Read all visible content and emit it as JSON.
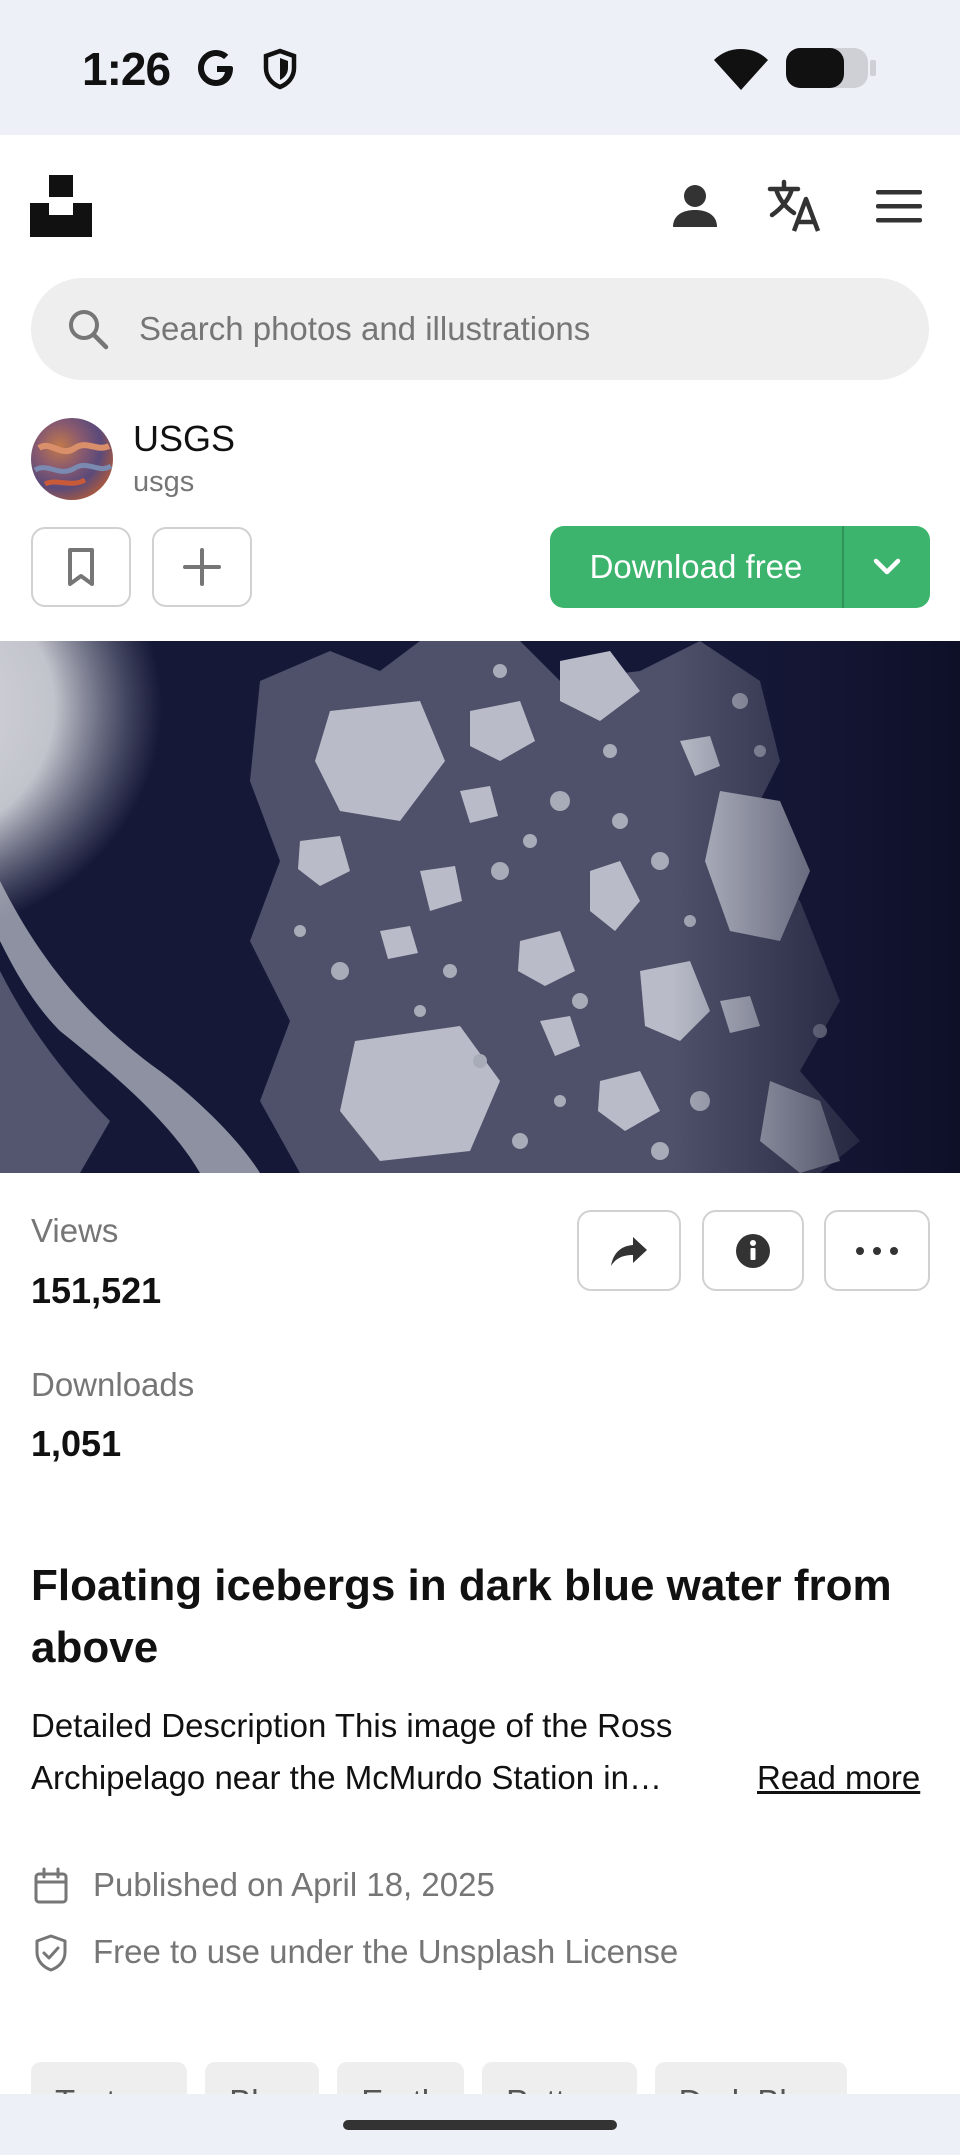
{
  "status_bar": {
    "time": "1:26",
    "g_label": "G"
  },
  "header": {
    "logo_icon": "unsplash-logo",
    "icons": [
      "user-icon",
      "translate-icon",
      "hamburger-menu-icon"
    ]
  },
  "search": {
    "placeholder": "Search photos and illustrations"
  },
  "author": {
    "name": "USGS",
    "handle": "usgs"
  },
  "actions": {
    "bookmark_icon": "bookmark-icon",
    "add_icon": "plus-icon",
    "download_label": "Download free",
    "download_color": "#3cb46e"
  },
  "photo": {
    "alt": "Floating icebergs in dark blue water from above",
    "water_color": "#141634"
  },
  "stats": {
    "views_label": "Views",
    "views_value": "151,521",
    "downloads_label": "Downloads",
    "downloads_value": "1,051"
  },
  "toolbar_icons": [
    "share-icon",
    "info-icon",
    "more-icon"
  ],
  "details": {
    "title": "Floating icebergs in dark blue water from above",
    "description_line1": "Detailed Description This image of the Ross",
    "description_line2": "Archipelago near the McMurdo Station in…",
    "read_more": "Read more",
    "published": "Published on April 18, 2025",
    "license": "Free to use under the Unsplash License"
  },
  "tags": [
    "Texture",
    "Blue",
    "Earth",
    "Pattern",
    "Dark Blue"
  ]
}
